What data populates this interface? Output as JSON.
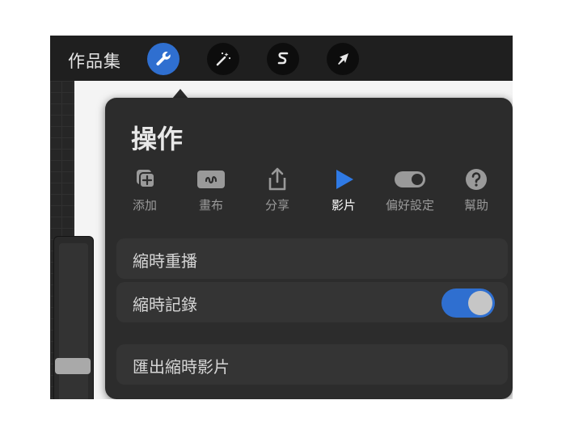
{
  "topbar": {
    "gallery_label": "作品集",
    "tools": [
      {
        "icon": "wrench-icon",
        "active": true
      },
      {
        "icon": "magic-wand-icon",
        "active": false
      },
      {
        "icon": "s-curve-icon",
        "active": false
      },
      {
        "icon": "arrow-cursor-icon",
        "active": false
      }
    ]
  },
  "panel": {
    "title": "操作",
    "tabs": [
      {
        "label": "添加",
        "icon": "add-icon"
      },
      {
        "label": "畫布",
        "icon": "canvas-icon"
      },
      {
        "label": "分享",
        "icon": "share-icon"
      },
      {
        "label": "影片",
        "icon": "play-icon",
        "active": true
      },
      {
        "label": "偏好設定",
        "icon": "toggle-icon"
      },
      {
        "label": "幫助",
        "icon": "help-icon"
      }
    ],
    "rows": {
      "replay": "縮時重播",
      "record": "縮時記錄",
      "record_on": true,
      "export": "匯出縮時影片"
    }
  },
  "colors": {
    "accent": "#2f6fd0",
    "panel": "#2c2c2c",
    "row": "#343434"
  }
}
